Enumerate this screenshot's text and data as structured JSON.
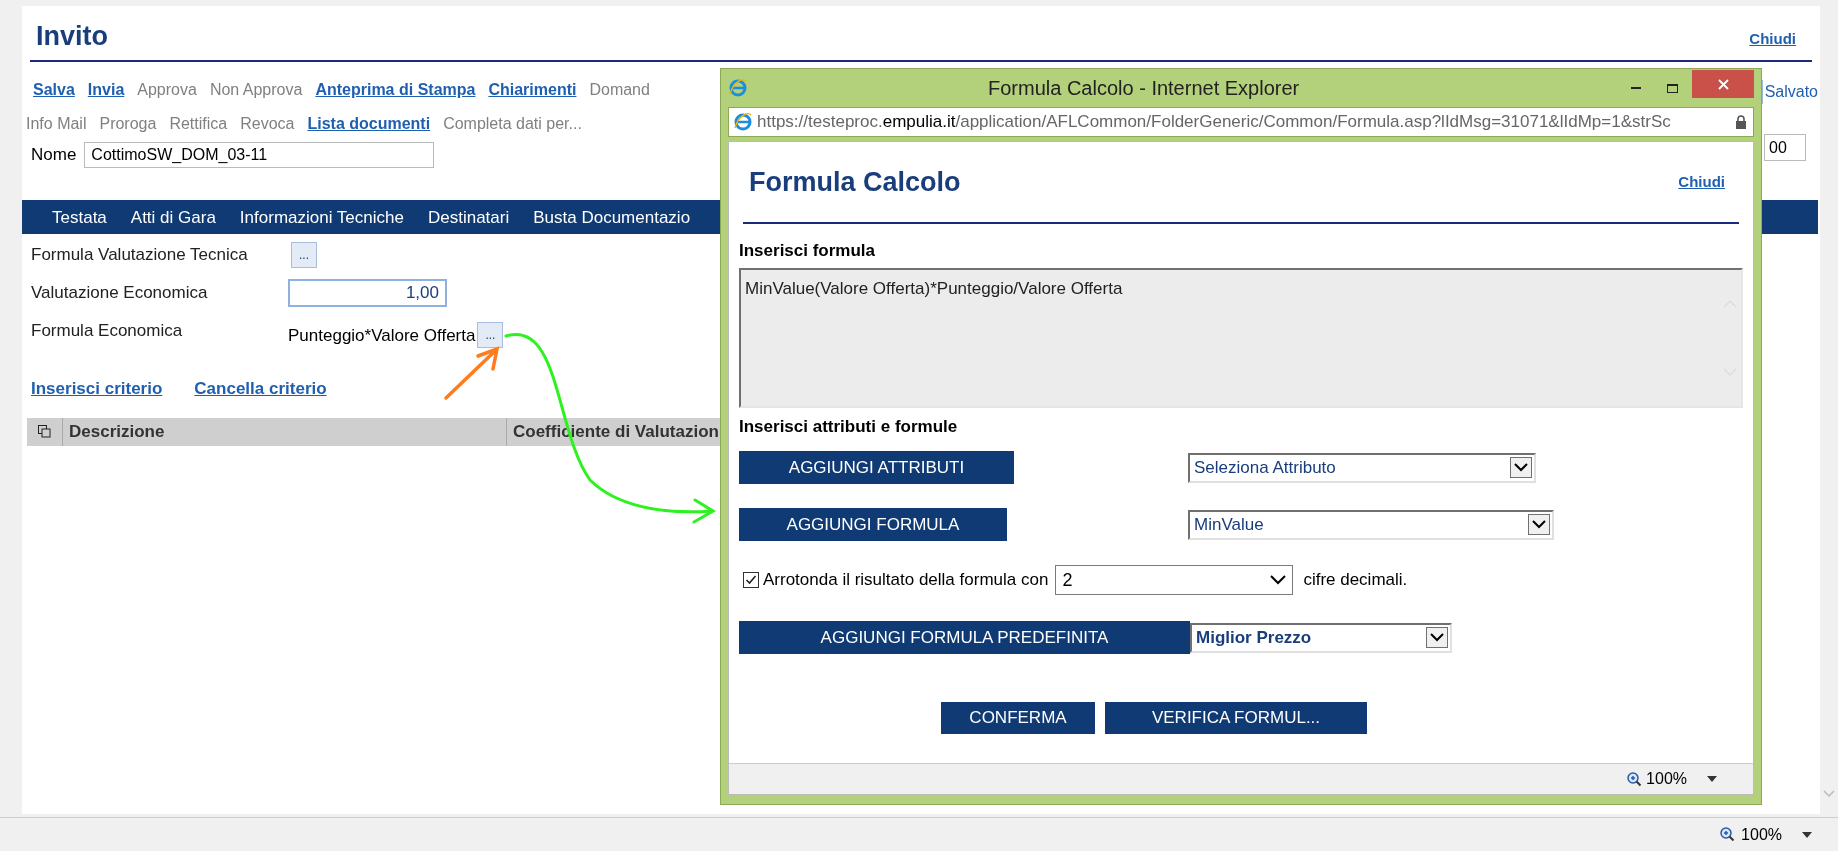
{
  "page": {
    "title": "Invito",
    "close_link": "Chiudi",
    "toolbar_rows": [
      [
        {
          "label": "Salva",
          "enabled": true
        },
        {
          "label": "Invia",
          "enabled": true
        },
        {
          "label": "Approva",
          "enabled": false
        },
        {
          "label": "Non Approva",
          "enabled": false
        },
        {
          "label": "Anteprima di Stampa",
          "enabled": true
        },
        {
          "label": "Chiarimenti",
          "enabled": true
        },
        {
          "label": "Domand",
          "enabled": false
        }
      ],
      [
        {
          "label": "Info Mail",
          "enabled": false
        },
        {
          "label": "Proroga",
          "enabled": false
        },
        {
          "label": "Rettifica",
          "enabled": false
        },
        {
          "label": "Revoca",
          "enabled": false
        },
        {
          "label": "Lista documenti",
          "enabled": true
        },
        {
          "label": "Completa dati per...",
          "enabled": false
        }
      ]
    ],
    "right_toolbar_item": {
      "label": "Salvato",
      "enabled": true
    },
    "name_field": {
      "label": "Nome",
      "value": "CottimoSW_DOM_03-11"
    },
    "right_field": {
      "value": "00"
    },
    "tabs": [
      "Testata",
      "Atti di Gara",
      "Informazioni Tecniche",
      "Destinatari",
      "Busta Documentazio"
    ],
    "fields": [
      {
        "kind": "button",
        "label": "Formula Valutazione Tecnica",
        "button": "..."
      },
      {
        "kind": "input",
        "label": "Valutazione Economica",
        "value": "1,00"
      },
      {
        "kind": "text_button",
        "label": "Formula Economica",
        "value": "Punteggio*Valore Offerta",
        "button": "..."
      }
    ],
    "actions": [
      "Inserisci criterio",
      "Cancella criterio"
    ],
    "table": {
      "columns": [
        "Descrizione",
        "Coefficiente di Valutazion"
      ]
    }
  },
  "popup": {
    "window_title": "Formula Calcolo - Internet Explorer",
    "url_parts": [
      {
        "text": "https://testeproc.",
        "emphasis": false
      },
      {
        "text": "empulia.it",
        "emphasis": true
      },
      {
        "text": "/application/AFLCommon/FolderGeneric/Common/Formula.asp?lIdMsg=31071&lIdMp=1&strSc",
        "emphasis": false
      }
    ],
    "heading": "Formula Calcolo",
    "close_link": "Chiudi",
    "formula_label": "Inserisci formula",
    "formula": "MinValue(Valore Offerta)*Punteggio/Valore Offerta",
    "section_label": "Inserisci attributi e formule",
    "rows": [
      {
        "kind": "button_select",
        "button": "AGGIUNGI ATTRIBUTI",
        "select": "Seleziona Attributo"
      },
      {
        "kind": "button_select",
        "button": "AGGIUNGI FORMULA",
        "select": "MinValue"
      },
      {
        "kind": "checkbox",
        "checked": true,
        "label": "Arrotonda il risultato della formula con",
        "select": "2",
        "suffix": "cifre decimali."
      },
      {
        "kind": "wide_button_select",
        "button": "AGGIUNGI FORMULA PREDEFINITA",
        "select": "Miglior Prezzo"
      }
    ],
    "buttons": [
      "CONFERMA",
      "VERIFICA FORMUL..."
    ],
    "zoom": "100%"
  },
  "status_bar": {
    "zoom": "100%"
  }
}
